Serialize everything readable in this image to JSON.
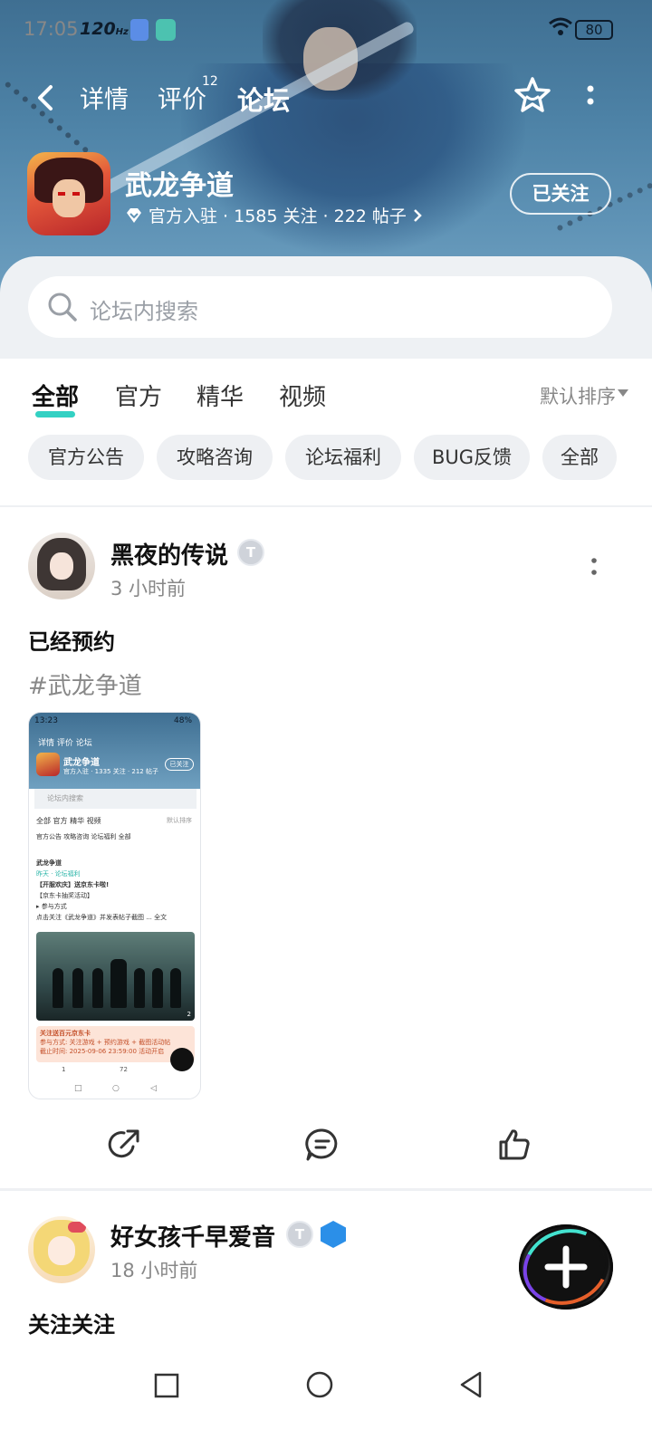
{
  "status_bar": {
    "time": "17:05",
    "refresh_rate": "120",
    "refresh_unit": "Hz",
    "battery": "80"
  },
  "nav": {
    "tabs": [
      {
        "label": "详情"
      },
      {
        "label": "评价",
        "badge": "12"
      },
      {
        "label": "论坛",
        "active": true
      }
    ],
    "icons": [
      "back-arrow-icon",
      "star-icon",
      "more-vertical-icon"
    ]
  },
  "game": {
    "title": "武龙争道",
    "meta": "官方入驻 · 1585 关注 · 222 帖子",
    "follow_label": "已关注"
  },
  "search": {
    "placeholder": "论坛内搜索"
  },
  "content_tabs": [
    "全部",
    "官方",
    "精华",
    "视频"
  ],
  "sort_label": "默认排序",
  "chips": [
    "官方公告",
    "攻略咨询",
    "论坛福利",
    "BUG反馈",
    "全部"
  ],
  "posts": [
    {
      "author": "黑夜的传说",
      "level": "T",
      "time": "3 小时前",
      "title": "已经预约",
      "tag": "#武龙争道",
      "screenshot": {
        "status": "13:23",
        "battery": "48%",
        "tabs": "详情  评价  论坛",
        "title": "武龙争道",
        "meta": "官方入驻 · 1335 关注 · 212 帖子",
        "follow": "已关注",
        "search": "论坛内搜索",
        "ctabs": "全部   官方   精华   视频",
        "sort": "默认排序",
        "chips": "官方公告   攻略咨询   论坛福利   全部",
        "post_author": "武龙争道",
        "post_sub": "昨天 · 论坛福利",
        "post_title": "【开服欢庆】送京东卡啦!",
        "post_l1": "【京东卡抽奖活动】",
        "post_l2": "▸ 参与方式",
        "post_l3": "点击关注《武龙争道》并发表帖子截图 ... 全文",
        "img_count": "2",
        "promo_title": "关注送百元京东卡",
        "promo_l1": "参与方式: 关注游戏 + 预约游戏 + 截图活动帖",
        "promo_l2": "截止时间: 2025-09-06 23:59:00 活动开启",
        "bar_share": "1",
        "bar_comment": "72"
      }
    },
    {
      "author": "好女孩千早爱音",
      "level": "T",
      "time": "18 小时前",
      "title": "关注关注"
    }
  ]
}
